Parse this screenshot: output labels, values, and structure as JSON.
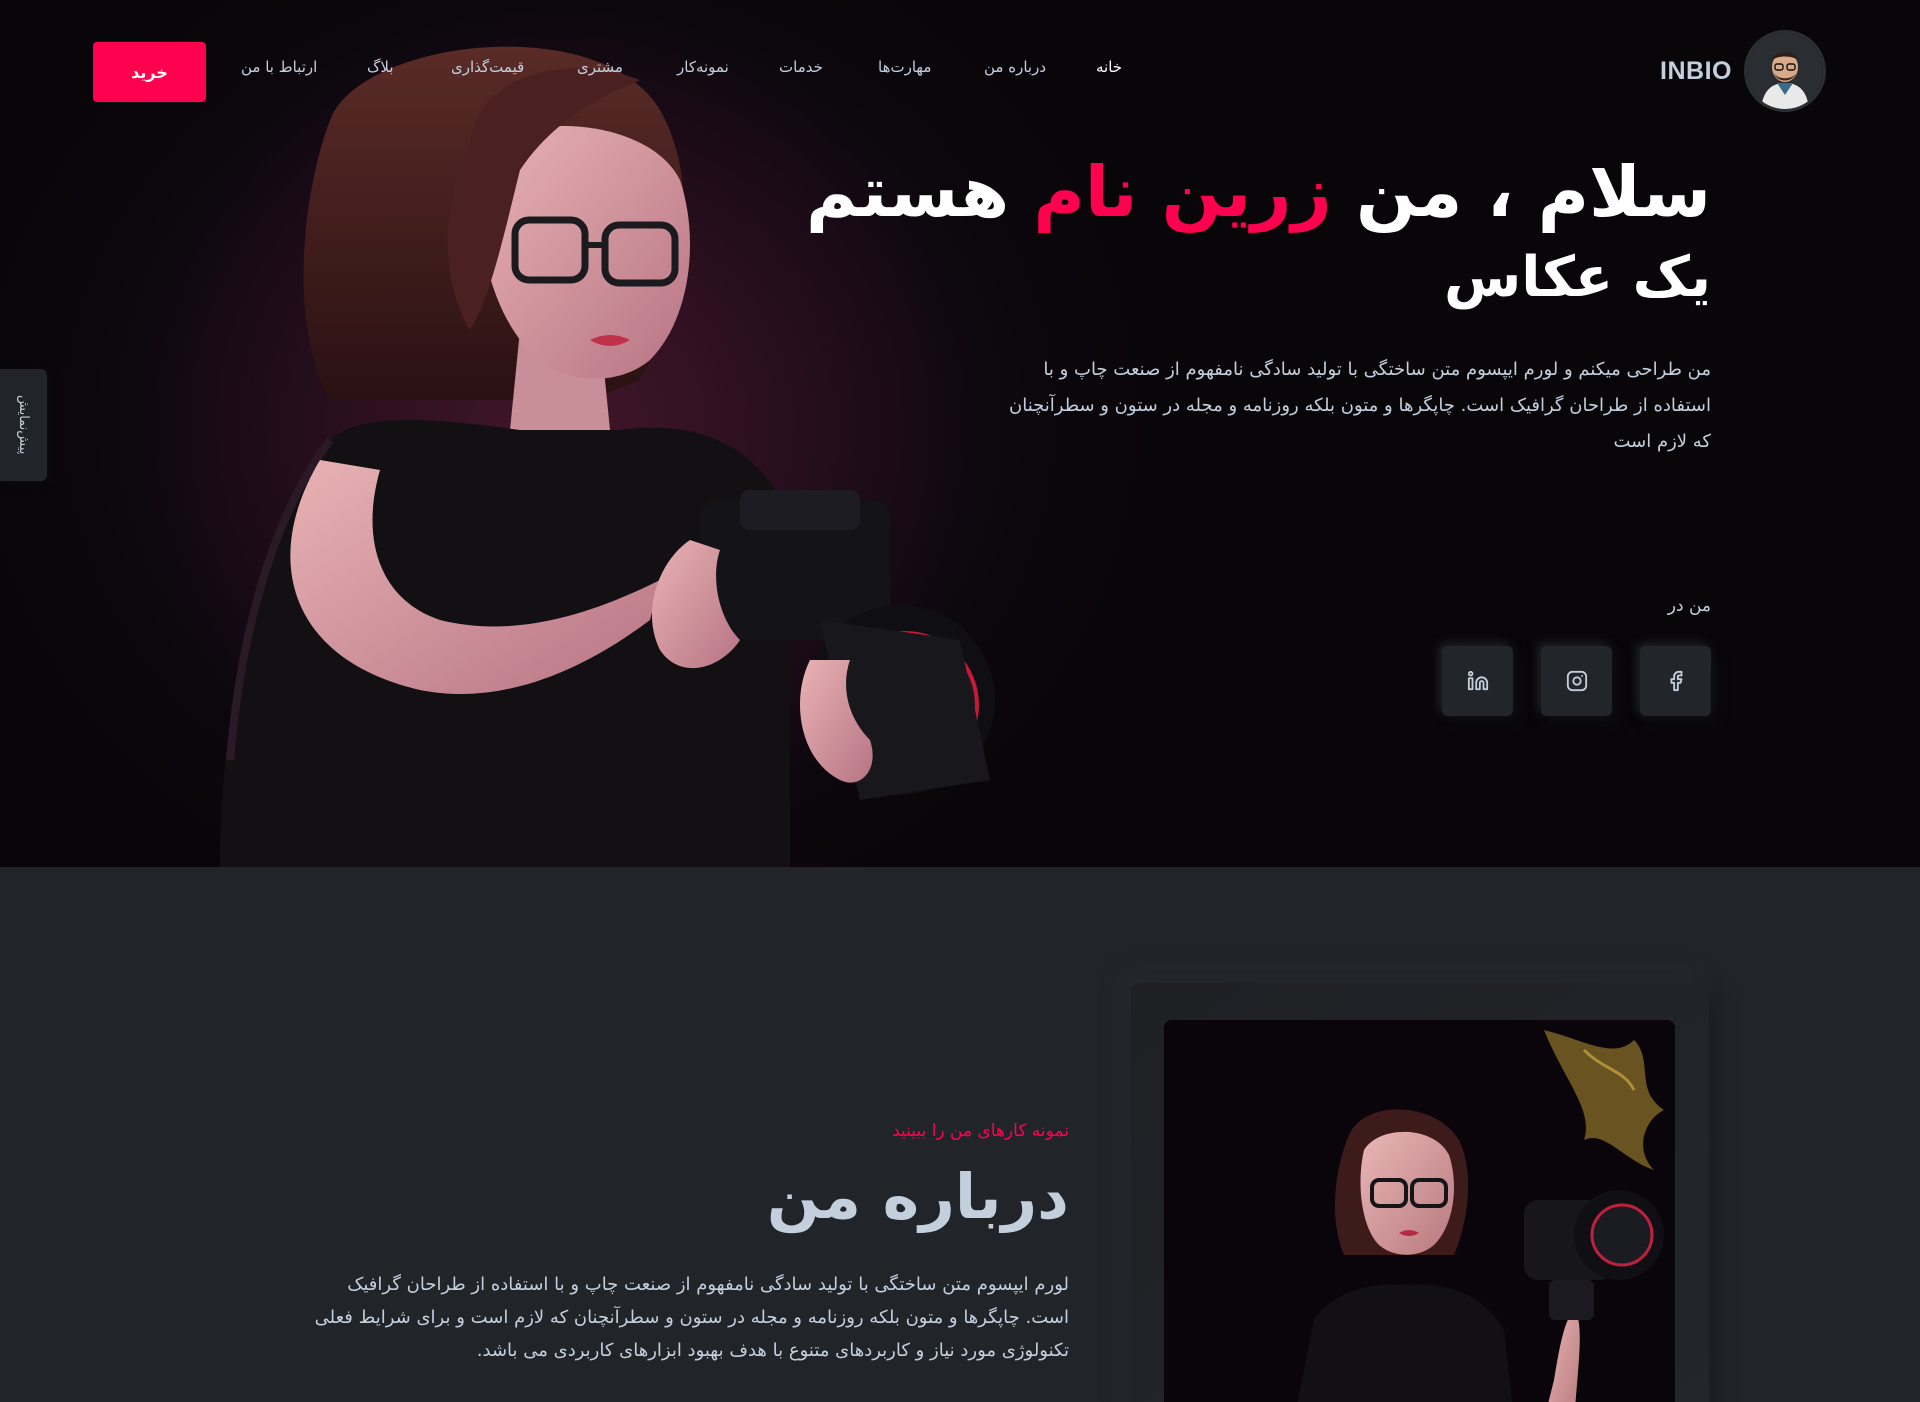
{
  "nav": {
    "buy_label": "خرید",
    "logo_text": "INBIO",
    "items": [
      {
        "label": "خانه",
        "active": true
      },
      {
        "label": "درباره من"
      },
      {
        "label": "مهارت‌ها"
      },
      {
        "label": "خدمات"
      },
      {
        "label": "نمونه‌کار"
      },
      {
        "label": "مشتری"
      },
      {
        "label": "قیمت‌گذاری"
      },
      {
        "label": "بلاگ"
      },
      {
        "label": "ارتباط با من"
      }
    ]
  },
  "hero": {
    "title_part1": "سلام ، من ",
    "title_highlight": "زرین نام",
    "title_part2": " هستم",
    "subtitle": "یک عکاس",
    "description": "من طراحی میکنم و لورم ایپسوم متن ساختگی با تولید سادگی نامفهوم از صنعت چاپ و با استفاده از طراحان گرافیک است. چاپگرها و متون بلکه روزنامه و مجله در ستون و سطرآنچنان که لازم است",
    "find_me_label": "من در",
    "social": [
      {
        "icon": "facebook-icon"
      },
      {
        "icon": "instagram-icon"
      },
      {
        "icon": "linkedin-icon"
      }
    ]
  },
  "side_tab": {
    "label": "پیش‌نمایش"
  },
  "about": {
    "kicker": "نمونه کارهای من را ببینید",
    "title": "درباره من",
    "text": "لورم ایپسوم متن ساختگی با تولید سادگی نامفهوم از صنعت چاپ و با استفاده از طراحان گرافیک است. چاپگرها و متون بلکه روزنامه و مجله در ستون و سطرآنچنان که لازم است و برای شرایط فعلی تکنولوژی مورد نیاز و کاربردهای متنوع با هدف بهبود ابزارهای کاربردی می باشد."
  },
  "colors": {
    "accent": "#ff014f",
    "background": "#212428",
    "text": "#c4cfde"
  }
}
